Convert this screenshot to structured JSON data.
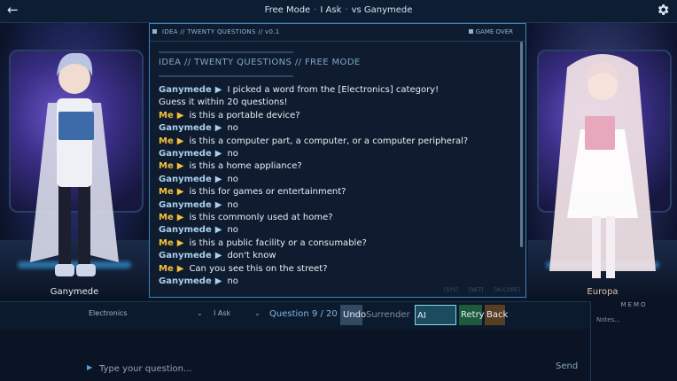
{
  "topbar": {
    "mode": "Free Mode",
    "role": "I Ask",
    "opponent": "vs Ganymede",
    "sep1": "·",
    "sep2": "·"
  },
  "characters": {
    "left_name": "Ganymede",
    "right_name": "Europa"
  },
  "panel": {
    "header_text": "IDEA // TWENTY QUESTIONS // v0.1",
    "status": "GAME OVER",
    "heading": "IDEA // TWENTY QUESTIONS // FREE MODE",
    "footer_tags": "[SYS] [NET] [AI-CORE]"
  },
  "chat": [
    {
      "who": "Ganymede",
      "role": "ai",
      "text": "I picked a word from the [Electronics] category!"
    },
    {
      "who": "",
      "role": "cont",
      "text": "Guess it within 20 questions!"
    },
    {
      "who": "Me",
      "role": "me",
      "text": "is this a portable device?"
    },
    {
      "who": "Ganymede",
      "role": "ai",
      "text": "no"
    },
    {
      "who": "Me",
      "role": "me",
      "text": "is this a computer part, a computer, or a computer peripheral?"
    },
    {
      "who": "Ganymede",
      "role": "ai",
      "text": "no"
    },
    {
      "who": "Me",
      "role": "me",
      "text": "is this a home appliance?"
    },
    {
      "who": "Ganymede",
      "role": "ai",
      "text": "no"
    },
    {
      "who": "Me",
      "role": "me",
      "text": "is this for games or entertainment?"
    },
    {
      "who": "Ganymede",
      "role": "ai",
      "text": "no"
    },
    {
      "who": "Me",
      "role": "me",
      "text": "is this commonly used at home?"
    },
    {
      "who": "Ganymede",
      "role": "ai",
      "text": "no"
    },
    {
      "who": "Me",
      "role": "me",
      "text": "is this a public facility or a consumable?"
    },
    {
      "who": "Ganymede",
      "role": "ai",
      "text": "don't know"
    },
    {
      "who": "Me",
      "role": "me",
      "text": "Can you see this on the street?"
    },
    {
      "who": "Ganymede",
      "role": "ai",
      "text": "no"
    }
  ],
  "speaker_marker": "▶",
  "controls": {
    "category": "Electronics",
    "mode": "I Ask",
    "question_label": "Question",
    "question_count": "9 / 20",
    "undo": "Undo",
    "surrender": "Surrender",
    "ai_review": "AI Review",
    "retry": "Retry",
    "back": "Back"
  },
  "input": {
    "placeholder": "Type your question...",
    "send": "Send"
  },
  "memo": {
    "title": "MEMO",
    "placeholder": "Notes..."
  },
  "icons": {
    "back": "back-arrow-icon",
    "settings": "gear-icon"
  }
}
